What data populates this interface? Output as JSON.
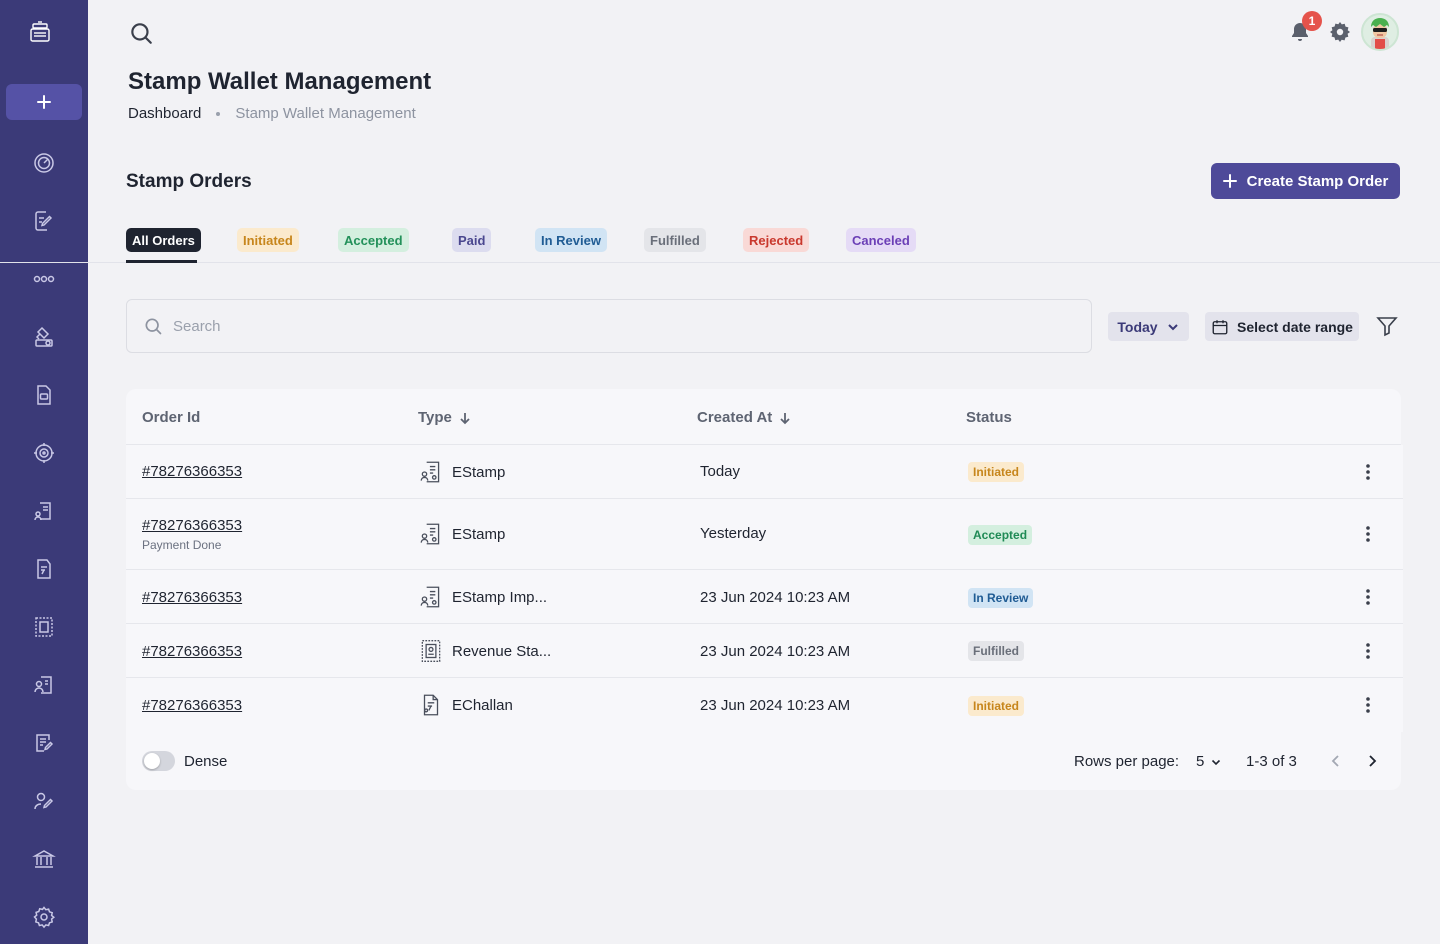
{
  "page": {
    "title": "Stamp Wallet Management",
    "breadcrumb": {
      "root": "Dashboard",
      "current": "Stamp Wallet Management"
    }
  },
  "header": {
    "notification_count": "1"
  },
  "sidebar": {
    "items": [
      "logo-icon",
      "add-icon",
      "dashboard-icon",
      "stamp-edit-icon",
      "link-icon",
      "stamp-hand-icon",
      "document-icon",
      "target-icon",
      "stamp-user-icon",
      "stamp-rupee-icon",
      "revenue-stamp-icon",
      "user-document-icon",
      "document-edit-icon",
      "user-edit-icon",
      "bank-icon",
      "settings-icon"
    ]
  },
  "section": {
    "title": "Stamp Orders",
    "create_label": "Create Stamp Order"
  },
  "tabs": [
    {
      "label": "All Orders",
      "bg": "#1f2430",
      "fg": "#ffffff"
    },
    {
      "label": "Initiated",
      "bg": "#fbeacd",
      "fg": "#c7861c"
    },
    {
      "label": "Accepted",
      "bg": "#d4efdf",
      "fg": "#23915a"
    },
    {
      "label": "Paid",
      "bg": "#dcdcef",
      "fg": "#4a478f"
    },
    {
      "label": "In Review",
      "bg": "#d1e4f4",
      "fg": "#205c94"
    },
    {
      "label": "Fulfilled",
      "bg": "#e4e5e9",
      "fg": "#6a6f7a"
    },
    {
      "label": "Rejected",
      "bg": "#f9d9d6",
      "fg": "#c9382d"
    },
    {
      "label": "Canceled",
      "bg": "#e5dbf6",
      "fg": "#6b3fb6"
    }
  ],
  "filters": {
    "search_placeholder": "Search",
    "period": "Today",
    "date_range": "Select date range"
  },
  "table": {
    "columns": {
      "order_id": "Order Id",
      "type": "Type",
      "created_at": "Created At",
      "status": "Status"
    },
    "rows": [
      {
        "order_id": "#78276366353",
        "sub": "",
        "type": "EStamp",
        "type_icon": "estamp-icon",
        "created_at": "Today",
        "status": "Initiated",
        "status_bg": "#fbeacd",
        "status_fg": "#c7861c"
      },
      {
        "order_id": "#78276366353",
        "sub": "Payment Done",
        "type": "EStamp",
        "type_icon": "estamp-icon",
        "created_at": "Yesterday",
        "status": "Accepted",
        "status_bg": "#d4efdf",
        "status_fg": "#1f8a55"
      },
      {
        "order_id": "#78276366353",
        "sub": "",
        "type": "EStamp Imp...",
        "type_icon": "estamp-icon",
        "created_at": "23 Jun 2024 10:23 AM",
        "status": "In Review",
        "status_bg": "#d1e4f4",
        "status_fg": "#205c94"
      },
      {
        "order_id": "#78276366353",
        "sub": "",
        "type": "Revenue Sta...",
        "type_icon": "revenue-stamp-icon",
        "created_at": "23 Jun 2024 10:23 AM",
        "status": "Fulfilled",
        "status_bg": "#e4e5e9",
        "status_fg": "#6a6f7a"
      },
      {
        "order_id": "#78276366353",
        "sub": "",
        "type": "EChallan",
        "type_icon": "echallan-icon",
        "created_at": "23 Jun 2024 10:23 AM",
        "status": "Initiated",
        "status_bg": "#fbeacd",
        "status_fg": "#c7861c"
      }
    ]
  },
  "pagination": {
    "dense_label": "Dense",
    "rows_per_page_label": "Rows per page:",
    "rows_per_page": "5",
    "range": "1-3 of 3"
  },
  "colors": {
    "sidebar": "#3b3a78",
    "accent": "#4e4a99",
    "background": "#f2f2f5"
  }
}
